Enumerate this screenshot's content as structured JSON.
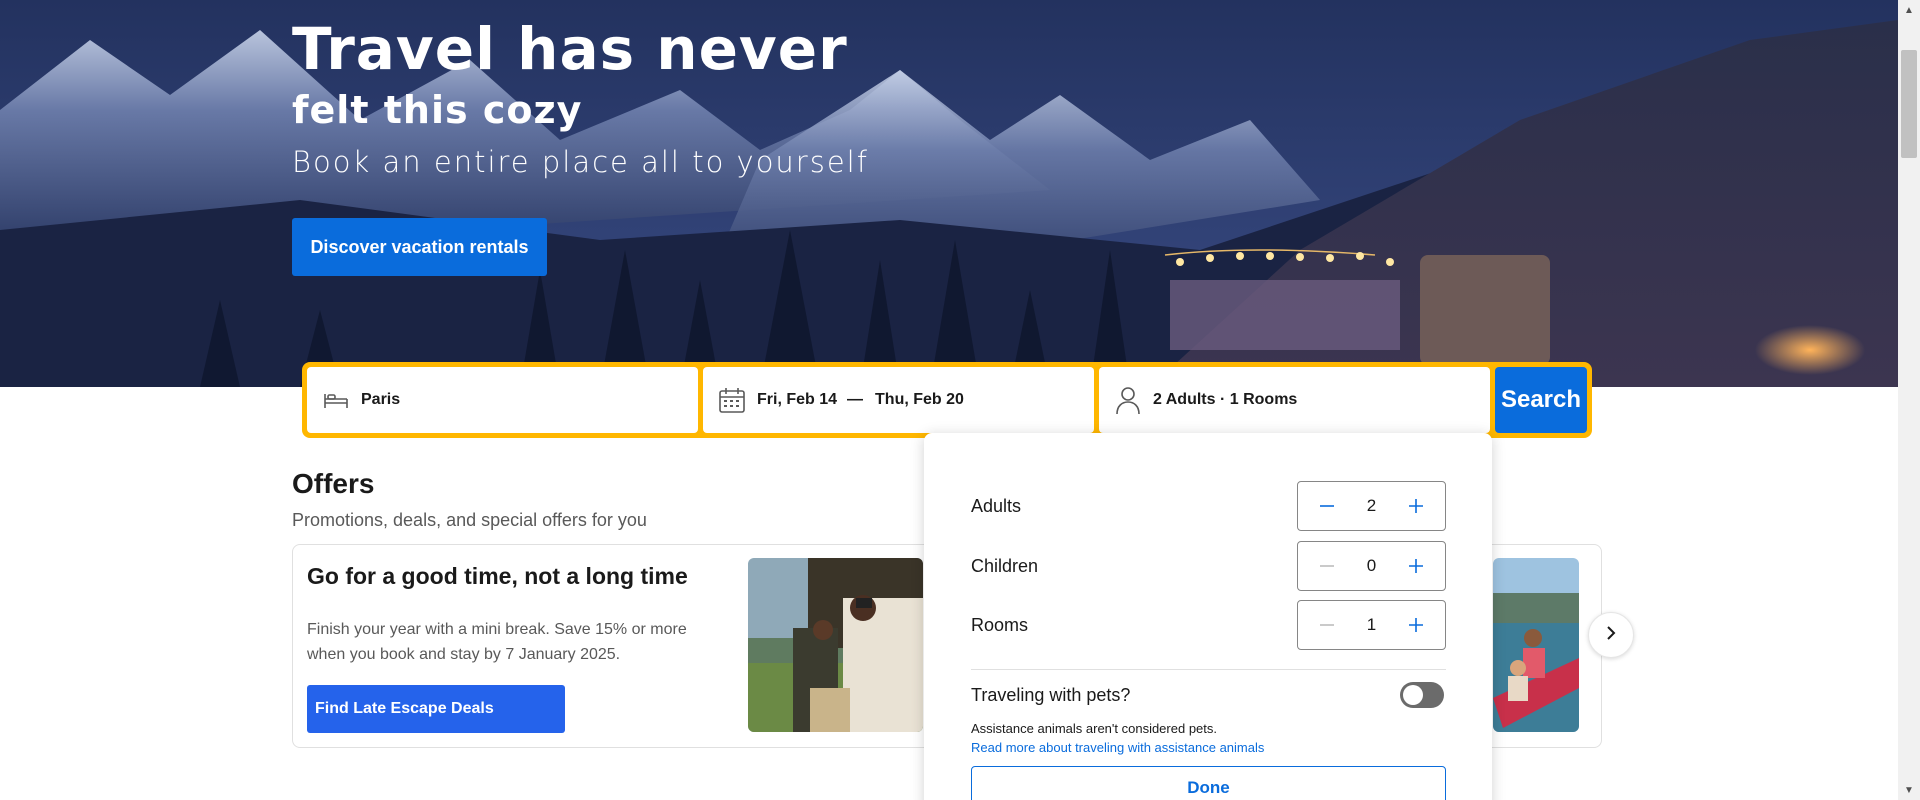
{
  "hero": {
    "title": "Travel has never",
    "subtitle": "felt this cozy",
    "tagline": "Book an entire place all to yourself",
    "cta_label": "Discover vacation rentals"
  },
  "search": {
    "destination": "Paris",
    "destination_icon": "bed-icon",
    "checkin": "Fri, Feb 14",
    "separator": "—",
    "checkout": "Thu, Feb 20",
    "dates_icon": "calendar-icon",
    "guests": "2 Adults · 1 Rooms",
    "guests_icon": "person-icon",
    "button_label": "Search"
  },
  "offers": {
    "title": "Offers",
    "subtitle": "Promotions, deals, and special offers for you",
    "card": {
      "heading": "Go for a good time, not a long time",
      "text": "Finish your year with a mini break. Save 15% or more when you book and stay by 7 January 2025.",
      "button_label": "Find Late Escape Deals"
    }
  },
  "guest_picker": {
    "rows": [
      {
        "label": "Adults",
        "value": "2"
      },
      {
        "label": "Children",
        "value": "0"
      },
      {
        "label": "Rooms",
        "value": "1"
      }
    ],
    "pets_label": "Traveling with pets?",
    "pets_enabled": false,
    "pets_note": "Assistance animals aren't considered pets.",
    "pets_link": "Read more about traveling with assistance animals",
    "done_label": "Done"
  },
  "colors": {
    "accent": "#0a6cdc",
    "search_border": "#ffb700",
    "offer_button": "#2563eb"
  }
}
